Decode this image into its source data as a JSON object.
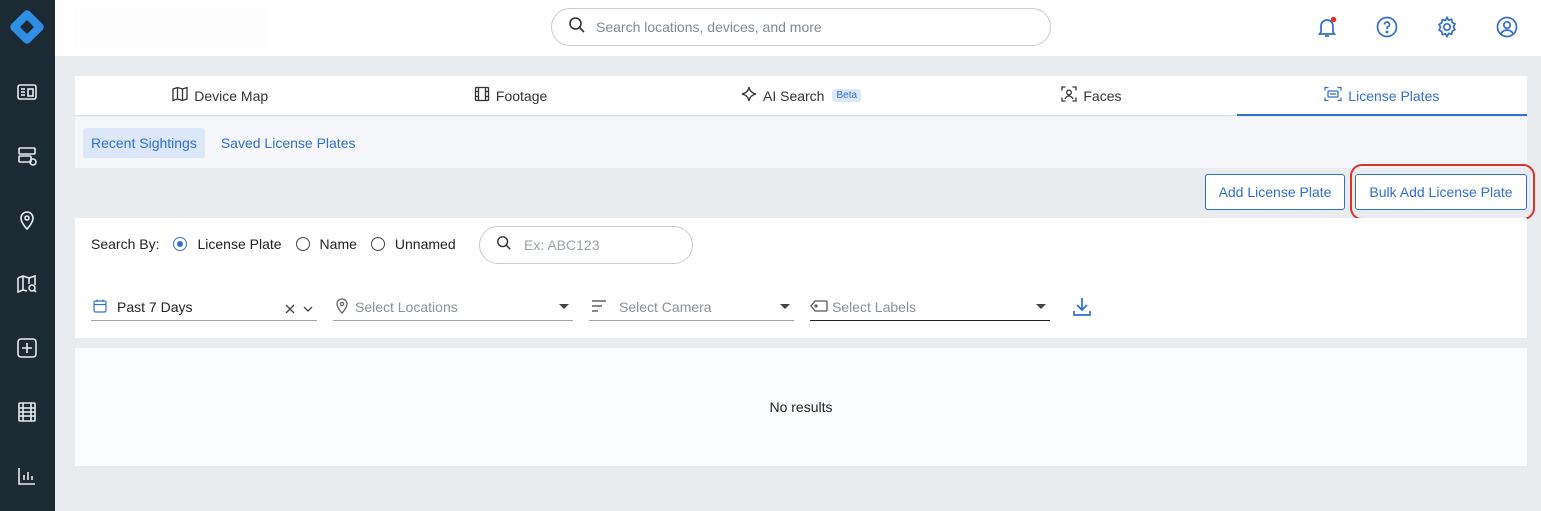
{
  "search": {
    "placeholder": "Search locations, devices, and more"
  },
  "tabs": [
    {
      "label": "Device Map",
      "icon": "map-icon"
    },
    {
      "label": "Footage",
      "icon": "film-icon"
    },
    {
      "label": "AI Search",
      "icon": "sparkle-icon",
      "badge": "Beta"
    },
    {
      "label": "Faces",
      "icon": "face-scan-icon"
    },
    {
      "label": "License Plates",
      "icon": "license-plate-icon",
      "active": true
    }
  ],
  "subtabs": [
    {
      "label": "Recent Sightings",
      "active": true
    },
    {
      "label": "Saved License Plates"
    }
  ],
  "actions": {
    "add_label": "Add License Plate",
    "bulk_add_label": "Bulk Add License Plate"
  },
  "filters": {
    "search_by_label": "Search By:",
    "options": [
      "License Plate",
      "Name",
      "Unnamed"
    ],
    "selected_option": "License Plate",
    "plate_placeholder": "Ex: ABC123",
    "date_value": "Past 7 Days",
    "locations_placeholder": "Select Locations",
    "camera_placeholder": "Select Camera",
    "labels_placeholder": "Select Labels"
  },
  "results": {
    "empty_text": "No results"
  },
  "colors": {
    "accent": "#2f6fd0",
    "sidebar": "#1c2b33",
    "highlight": "#d9342b",
    "notification_dot": "#e0332c"
  }
}
